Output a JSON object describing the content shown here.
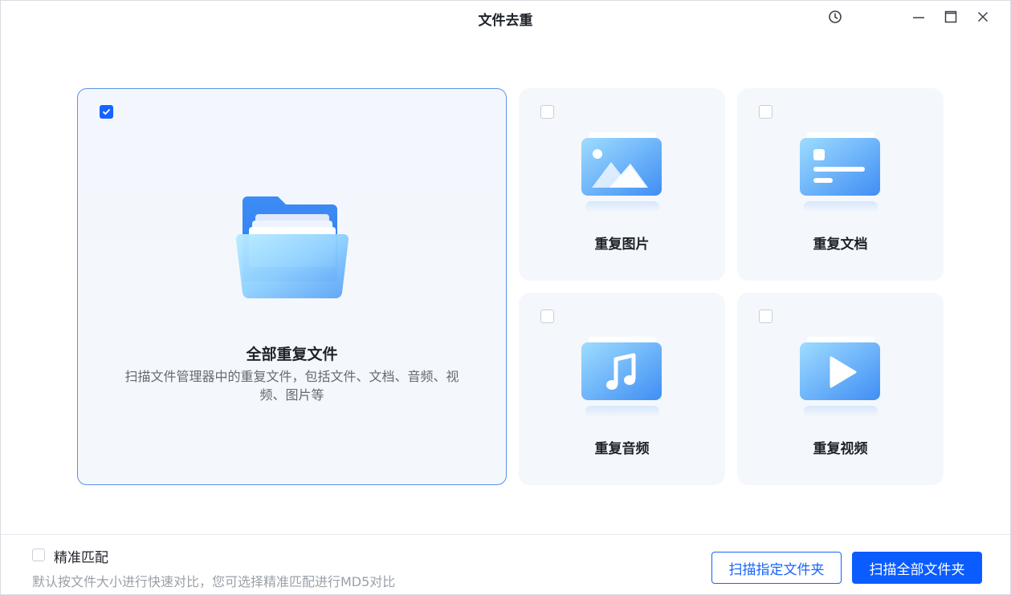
{
  "window": {
    "title": "文件去重"
  },
  "cards": {
    "all": {
      "title": "全部重复文件",
      "description": "扫描文件管理器中的重复文件，包括文件、文档、音频、视频、图片等",
      "checked": true
    },
    "images": {
      "label": "重复图片",
      "checked": false,
      "icon": "image-icon"
    },
    "documents": {
      "label": "重复文档",
      "checked": false,
      "icon": "document-icon"
    },
    "audio": {
      "label": "重复音频",
      "checked": false,
      "icon": "music-icon"
    },
    "video": {
      "label": "重复视频",
      "checked": false,
      "icon": "video-play-icon"
    }
  },
  "footer": {
    "precise_match_label": "精准匹配",
    "precise_match_checked": false,
    "hint": "默认按文件大小进行快速对比，您可选择精准匹配进行MD5对比",
    "scan_folder_label": "扫描指定文件夹",
    "scan_all_label": "扫描全部文件夹"
  },
  "colors": {
    "accent": "#1664ff",
    "card_bg": "#f4f7fc",
    "selected_border": "#5a92e6"
  }
}
